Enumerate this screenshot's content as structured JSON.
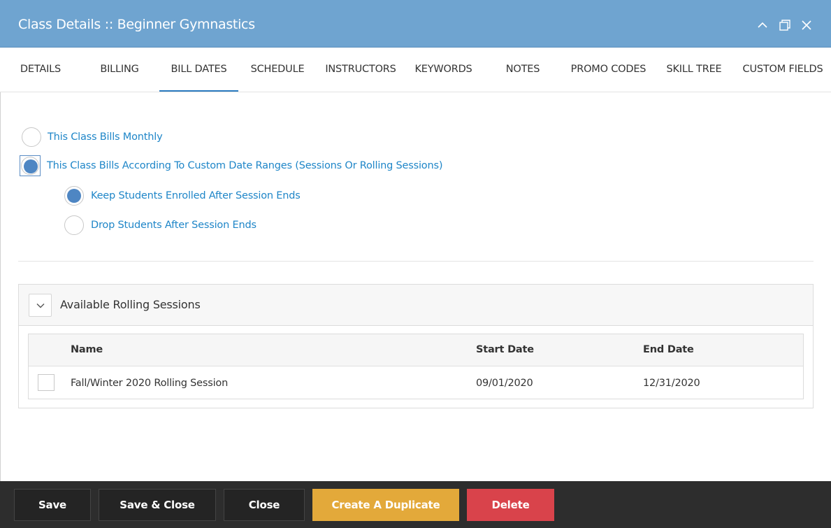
{
  "window": {
    "title": "Class Details :: Beginner Gymnastics"
  },
  "tabs": [
    {
      "label": "DETAILS"
    },
    {
      "label": "BILLING"
    },
    {
      "label": "BILL DATES",
      "active": true
    },
    {
      "label": "SCHEDULE"
    },
    {
      "label": "INSTRUCTORS"
    },
    {
      "label": "KEYWORDS"
    },
    {
      "label": "NOTES"
    },
    {
      "label": "PROMO CODES"
    },
    {
      "label": "SKILL TREE"
    },
    {
      "label": "CUSTOM FIELDS"
    }
  ],
  "billing_options": {
    "monthly": {
      "label": "This Class Bills Monthly",
      "checked": false
    },
    "custom": {
      "label": "This Class Bills According To Custom Date Ranges (Sessions Or Rolling Sessions)",
      "checked": true
    },
    "keep_enrolled": {
      "label": "Keep Students Enrolled After Session Ends",
      "checked": true
    },
    "drop_students": {
      "label": "Drop Students After Session Ends",
      "checked": false
    }
  },
  "sessions_panel": {
    "title": "Available Rolling Sessions",
    "columns": {
      "name": "Name",
      "start": "Start Date",
      "end": "End Date"
    },
    "rows": [
      {
        "name": "Fall/Winter 2020 Rolling Session",
        "start": "09/01/2020",
        "end": "12/31/2020",
        "selected": false
      }
    ]
  },
  "footer": {
    "save": "Save",
    "save_close": "Save & Close",
    "close": "Close",
    "duplicate": "Create A Duplicate",
    "delete": "Delete"
  },
  "colors": {
    "titlebar": "#6fa4d0",
    "link_blue": "#1f86c8",
    "radio_fill": "#4e86c3",
    "duplicate_button": "#e3a93a",
    "delete_button": "#d9434b",
    "footer_bg": "#2d2d2d"
  },
  "icons": {
    "minimize": "chevron-up-icon",
    "maximize": "restore-window-icon",
    "close": "close-icon",
    "collapse": "chevron-down-icon"
  }
}
